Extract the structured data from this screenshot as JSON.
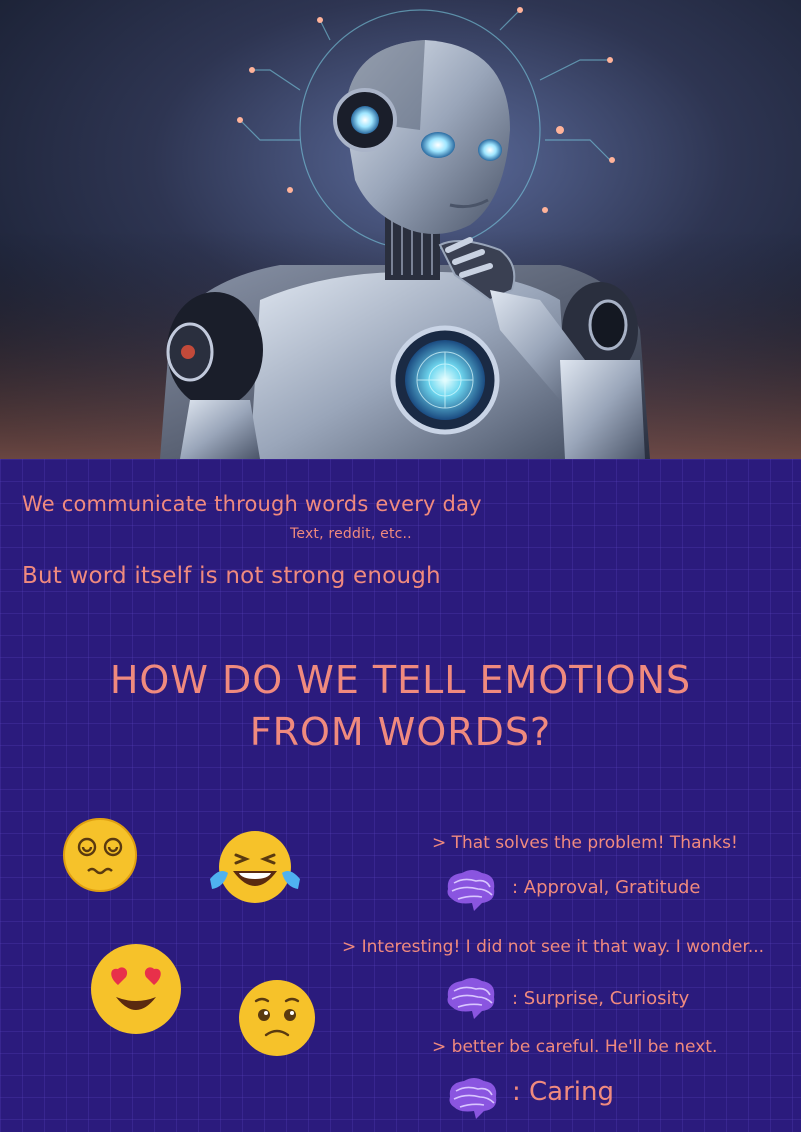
{
  "intro": {
    "line1": "We communicate through words every day",
    "sub": "Text, reddit, etc..",
    "line2": "But word itself is not strong enough"
  },
  "headline": {
    "line1": "HOW DO WE TELL EMOTIONS",
    "line2": "FROM WORDS?"
  },
  "emojis": [
    "dizzy-face-icon",
    "tears-of-joy-icon",
    "heart-eyes-icon",
    "pleading-face-icon"
  ],
  "examples": [
    {
      "message": "> That solves the problem! Thanks!",
      "label": ": Approval, Gratitude",
      "icon": "brain-icon"
    },
    {
      "message": "> Interesting! I did not see it that way. I wonder...",
      "label": ": Surprise, Curiosity",
      "icon": "brain-icon"
    },
    {
      "message": "> better be careful. He'll be next.",
      "label": ": Caring",
      "icon": "brain-icon"
    }
  ],
  "colors": {
    "panel": "#2b1b7d",
    "text": "#f08a7e",
    "brain": "#8a55e0",
    "emoji": "#f6c22a"
  }
}
